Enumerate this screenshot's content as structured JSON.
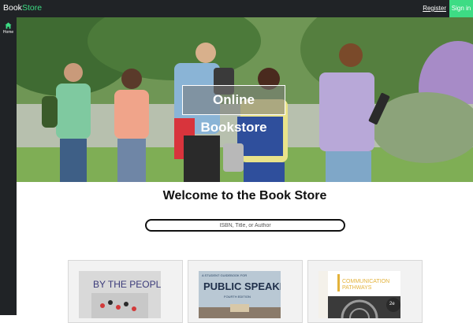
{
  "topbar": {
    "brand_prefix": "Book",
    "brand_suffix": "Store",
    "register_label": "Register",
    "signin_label": "Sign in"
  },
  "sidebar": {
    "items": [
      {
        "label": "Home",
        "icon": "home-icon"
      }
    ]
  },
  "hero": {
    "title": "Online Bookstore"
  },
  "main": {
    "welcome": "Welcome to the Book Store",
    "search_placeholder": "ISBN, Title, or Author"
  },
  "books": [
    {
      "cover_title": "BY THE PEOPLE"
    },
    {
      "cover_kicker": "A STUDENT GUIDEBOOK FOR",
      "cover_title": "PUBLIC SPEAKING",
      "cover_subtitle": "FOURTH EDITION"
    },
    {
      "cover_title_line1": "COMMUNICATION",
      "cover_title_line2": "PATHWAYS",
      "edition": "2e"
    }
  ],
  "colors": {
    "accent": "#3ddc84",
    "bar": "#202326"
  }
}
